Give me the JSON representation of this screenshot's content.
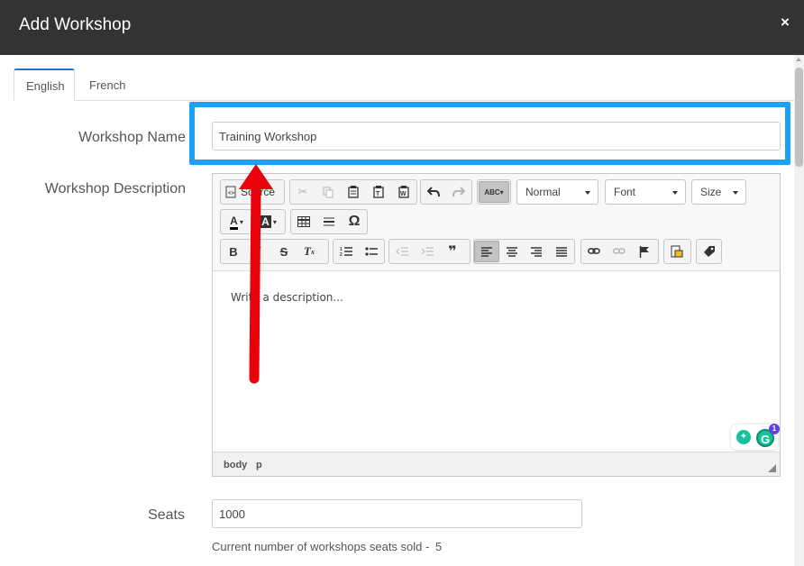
{
  "modal": {
    "title": "Add Workshop",
    "close_label": "×"
  },
  "tabs": [
    {
      "label": "English",
      "active": true
    },
    {
      "label": "French",
      "active": false
    }
  ],
  "form": {
    "name_label": "Workshop Name",
    "name_value": "Training Workshop",
    "description_label": "Workshop Description",
    "description_placeholder": "Write a description...",
    "seats_label": "Seats",
    "seats_value": "1000",
    "seats_sold_text": "Current number of workshops seats sold -",
    "seats_sold_value": "5"
  },
  "editor": {
    "source_label": "Source",
    "format_combo": "Normal",
    "font_combo": "Font",
    "size_combo": "Size",
    "bold": "B",
    "italic": "I",
    "strike": "S",
    "special_char": "Ω",
    "status_path": [
      "body",
      "p"
    ]
  },
  "grammarly": {
    "badge_count": "1",
    "g_letter": "G"
  },
  "colors": {
    "header_bg": "#333333",
    "highlight": "#1da1f2",
    "arrow": "#e8000b",
    "tab_accent": "#2a72c2"
  },
  "icons": [
    "close-icon",
    "source-icon",
    "cut-icon",
    "copy-icon",
    "paste-icon",
    "paste-text-icon",
    "paste-word-icon",
    "undo-icon",
    "redo-icon",
    "spellcheck-icon",
    "text-color-icon",
    "bg-color-icon",
    "table-icon",
    "horizontal-line-icon",
    "special-char-icon",
    "bold-icon",
    "italic-icon",
    "strike-icon",
    "remove-format-icon",
    "numbered-list-icon",
    "bullet-list-icon",
    "outdent-icon",
    "indent-icon",
    "blockquote-icon",
    "align-left-icon",
    "align-center-icon",
    "align-right-icon",
    "justify-icon",
    "link-icon",
    "unlink-icon",
    "anchor-icon",
    "image-icon",
    "tag-icon",
    "grammarly-icon"
  ]
}
